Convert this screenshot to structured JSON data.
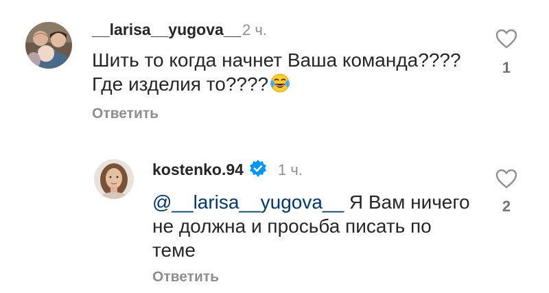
{
  "comments": [
    {
      "username": "__larisa__yugova__",
      "time": "2 ч.",
      "text_line1": "Шить то когда начнет Ваша команда????",
      "text_line2": "Где изделия то????",
      "emoji": "laughing-tears-emoji",
      "reply_label": "Ответить",
      "like_count": "1",
      "verified": false
    },
    {
      "username": "kostenko.94",
      "time": "1 ч.",
      "mention": "@__larisa__yugova__",
      "text_line1": " Я Вам ничего",
      "text_line2": "не должна и просьба писать по",
      "text_line3": "теме",
      "reply_label": "Ответить",
      "like_count": "2",
      "verified": true
    }
  ],
  "colors": {
    "text": "#262626",
    "secondary": "#8e8e8e",
    "mention": "#00376b",
    "verified": "#0095f6"
  }
}
